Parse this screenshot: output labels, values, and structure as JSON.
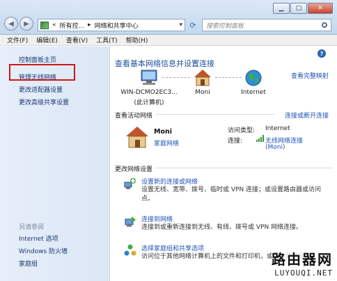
{
  "window": {
    "minimize": "▁",
    "maximize": "□",
    "close": "✕"
  },
  "address": {
    "prefix": "«",
    "crumb1": "所有控...",
    "sep": "▸",
    "crumb2": "网络和共享中心",
    "dropdown": "▾",
    "search_placeholder": "搜索控制面板"
  },
  "menu": [
    "文件(F)",
    "编辑(E)",
    "查看(V)",
    "工具(T)",
    "帮助(H)"
  ],
  "sidebar": {
    "items": [
      {
        "label": "控制面板主页"
      },
      {
        "label": "管理无线网络"
      },
      {
        "label": "更改适配器设置"
      },
      {
        "label": "更改高级共享设置"
      }
    ],
    "see_also_title": "另请参阅",
    "see_also": [
      {
        "label": "Internet 选项"
      },
      {
        "label": "Windows 防火墙"
      },
      {
        "label": "家庭组"
      }
    ]
  },
  "main": {
    "help": "?",
    "title": "查看基本网络信息并设置连接",
    "full_map_link": "查看完整映射",
    "map": {
      "computer_name": "WIN-DCMO2EC3...",
      "computer_sub": "(此计算机)",
      "network": "Moni",
      "internet": "Internet"
    },
    "active_section": "查看活动网络",
    "connect_disconnect": "连接或断开连接",
    "active_network": {
      "name": "Moni",
      "type": "家庭网络",
      "access_label": "访问类型:",
      "access_value": "Internet",
      "conn_label": "连接:",
      "conn_value": "无线网络连接",
      "conn_value2": "(Moni)"
    },
    "change_section": "更改网络设置",
    "tasks": [
      {
        "link": "设置新的连接或网络",
        "desc": "设置无线、宽带、拨号、临时或 VPN 连接；或设置路由器或访问点。"
      },
      {
        "link": "连接到网络",
        "desc": "连接到或重新连接到无线、有线、拨号或 VPN 网络连接。"
      },
      {
        "link": "选择家庭组和共享选项",
        "desc": "访问位于其他网络计算机上的文件和打印机，或更改共享设置。"
      }
    ]
  },
  "watermark": {
    "cn": "路由器网",
    "en": "LUYOUQI.NET"
  }
}
